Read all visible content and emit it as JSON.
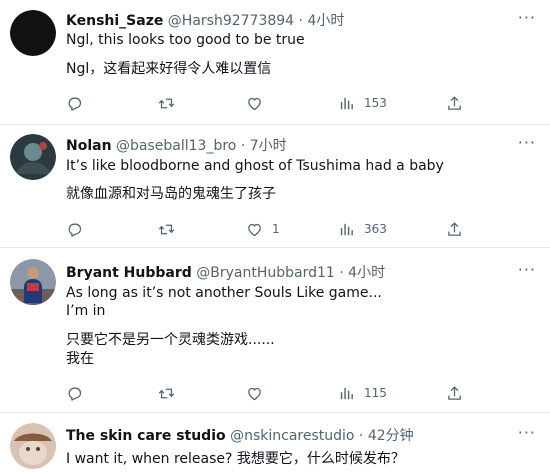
{
  "tweets": [
    {
      "name": "Kenshi_Saze",
      "handle": "@Harsh92773894",
      "dot": "·",
      "time": "4小时",
      "more": "···",
      "lines": [
        "Ngl, this looks too good to be true",
        "Ngl，这看起来好得令人难以置信"
      ],
      "replies": "",
      "retweets": "",
      "likes": "",
      "views": "153"
    },
    {
      "name": "Nolan",
      "handle": "@baseball13_bro",
      "dot": "·",
      "time": "7小时",
      "more": "···",
      "lines": [
        "It’s like bloodborne and ghost of Tsushima had a baby",
        "就像血源和对马岛的鬼魂生了孩子"
      ],
      "replies": "",
      "retweets": "",
      "likes": "1",
      "views": "363"
    },
    {
      "name": "Bryant Hubbard",
      "handle": "@BryantHubbard11",
      "dot": "·",
      "time": "4小时",
      "more": "···",
      "lines": [
        "As long as it’s not another Souls Like game...",
        "I’m in",
        "只要它不是另一个灵魂类游戏......",
        "我在"
      ],
      "replies": "",
      "retweets": "",
      "likes": "",
      "views": "115"
    },
    {
      "name": "The skin care studio",
      "handle": "@nskincarestudio",
      "dot": "·",
      "time": "42分钟",
      "more": "···",
      "lines": [
        "I want it, when release? 我想要它，什么时候发布？"
      ]
    }
  ],
  "icons": {
    "reply": "reply-icon",
    "retweet": "retweet-icon",
    "like": "heart-icon",
    "views": "views-icon",
    "share": "share-icon",
    "more": "more-icon"
  },
  "colors": {
    "text": "#0f1419",
    "secondary": "#536471",
    "divider": "#e6e9ec"
  }
}
